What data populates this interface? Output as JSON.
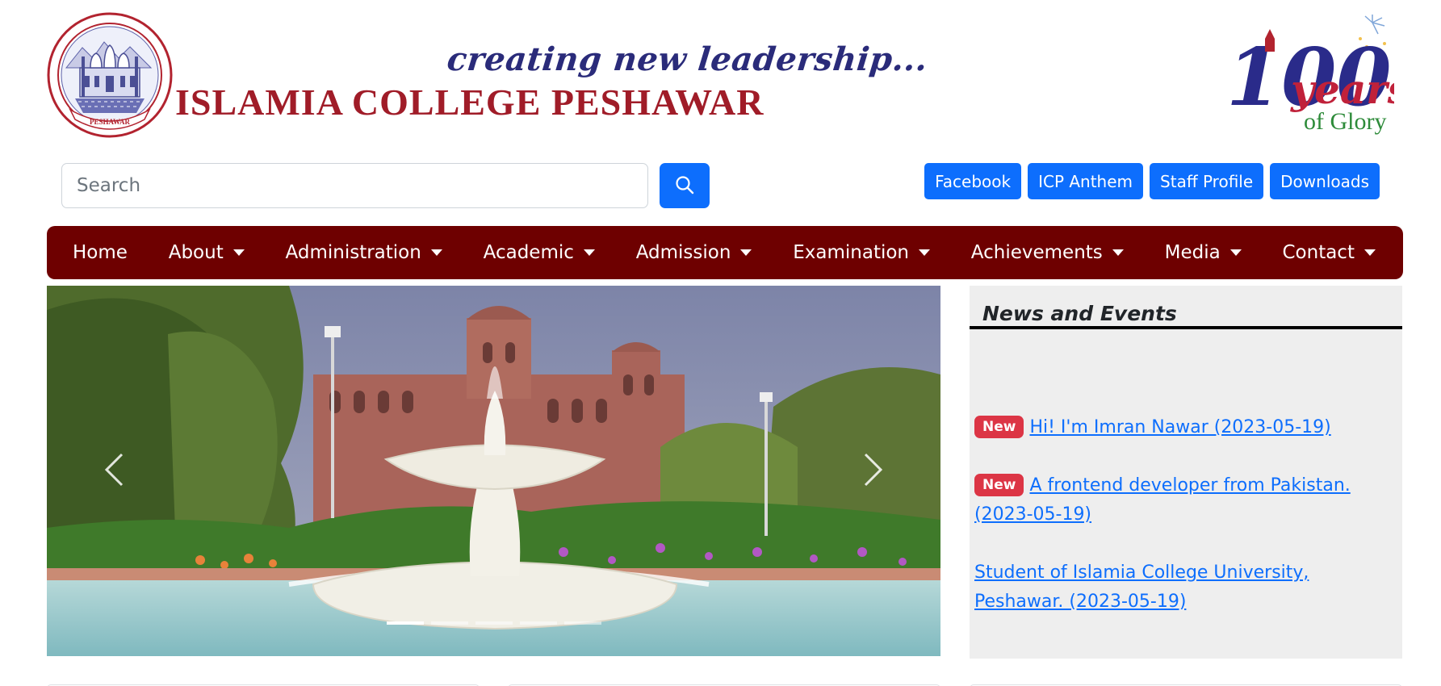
{
  "header": {
    "tagline": "creating new leadership...",
    "college_name": "ISLAMIA COLLEGE  PESHAWAR",
    "seal_text": "PESHAWAR",
    "centenary": {
      "number": "100",
      "word": "years",
      "sub": "of Glory"
    }
  },
  "search": {
    "placeholder": "Search",
    "value": ""
  },
  "quick_links": [
    "Facebook",
    "ICP Anthem",
    "Staff Profile",
    "Downloads"
  ],
  "nav": {
    "home": "Home",
    "about": "About",
    "administration": "Administration",
    "academic": "Academic",
    "admission": "Admission",
    "examination": "Examination",
    "achievements": "Achievements",
    "media": "Media",
    "contact": "Contact"
  },
  "carousel": {
    "slide_count": 5,
    "active_slide": 1
  },
  "news": {
    "title": "News and Events",
    "items": [
      {
        "badge": "New",
        "text": "Hi! I'm Imran Nawar (2023-05-19)"
      },
      {
        "badge": "New",
        "text": "A frontend developer from Pakistan. (2023-05-19)"
      },
      {
        "badge": "",
        "text": "Student of Islamia College University, Peshawar. (2023-05-19)"
      }
    ]
  },
  "colors": {
    "navbar": "#6e0000",
    "primary": "#0d6efd",
    "badge": "#dc3545",
    "college_red": "#a01c28",
    "tagline_blue": "#2a2b7a",
    "news_panel": "#eeeeee"
  },
  "icons": {
    "search_button": "search-icon",
    "carousel_prev": "chevron-left-icon",
    "carousel_next": "chevron-right-icon"
  }
}
